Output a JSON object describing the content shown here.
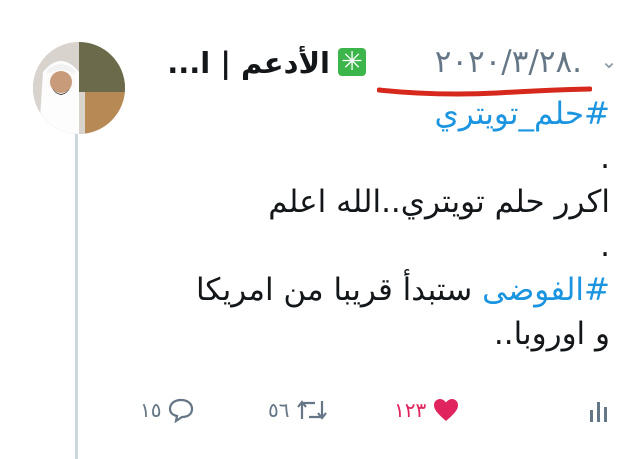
{
  "tweet": {
    "author_name": "الأدعم | ا...",
    "date": ".٢٠٢٠/٣/٢٨",
    "chevron_icon": "chevron-down-icon",
    "lines": [
      {
        "text": "#حلم_تويتري",
        "type": "hashtag"
      },
      {
        "text": ".",
        "type": "text"
      },
      {
        "text": "اكرر حلم تويتري..الله اعلم",
        "type": "text"
      },
      {
        "text": ".",
        "type": "text"
      }
    ],
    "line5_hashtag": "#الفوضى",
    "line5_rest": " ستبدأ قريبا من امريكا",
    "line6": "و اوروبا..",
    "replies": "١٥",
    "retweets": "٥٦",
    "likes": "١٢٣"
  },
  "colors": {
    "hashtag": "#1b95e0",
    "like": "#e0245e",
    "badge": "#3cb54a",
    "underline_annotation": "#d6281c",
    "muted": "#657786"
  }
}
